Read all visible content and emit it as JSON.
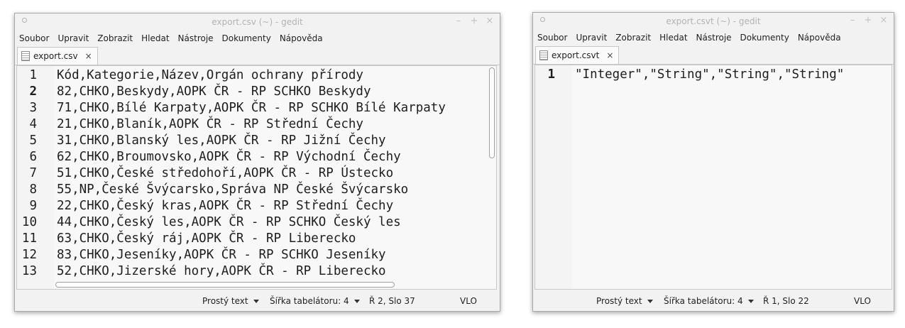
{
  "windows": [
    {
      "title": "export.csv (~) - gedit",
      "window_buttons": [
        "–",
        "+",
        "×"
      ],
      "menu": [
        "Soubor",
        "Upravit",
        "Zobrazit",
        "Hledat",
        "Nástroje",
        "Dokumenty",
        "Nápověda"
      ],
      "tab": {
        "label": "export.csv",
        "close": "×"
      },
      "current_line": 2,
      "lines": [
        {
          "num": "1",
          "text": "Kód,Kategorie,Název,Orgán ochrany přírody"
        },
        {
          "num": "2",
          "text": "82,CHKO,Beskydy,AOPK ČR - RP SCHKO Beskydy"
        },
        {
          "num": "3",
          "text": "71,CHKO,Bílé Karpaty,AOPK ČR - RP SCHKO Bílé Karpaty"
        },
        {
          "num": "4",
          "text": "21,CHKO,Blaník,AOPK ČR - RP Střední Čechy"
        },
        {
          "num": "5",
          "text": "31,CHKO,Blanský les,AOPK ČR - RP Jižní Čechy"
        },
        {
          "num": "6",
          "text": "62,CHKO,Broumovsko,AOPK ČR - RP Východní Čechy"
        },
        {
          "num": "7",
          "text": "51,CHKO,České středohoří,AOPK ČR - RP Ústecko"
        },
        {
          "num": "8",
          "text": "55,NP,České Švýcarsko,Správa NP České Švýcarsko"
        },
        {
          "num": "9",
          "text": "22,CHKO,Český kras,AOPK ČR - RP Střední Čechy"
        },
        {
          "num": "10",
          "text": "44,CHKO,Český les,AOPK ČR - RP SCHKO Český les"
        },
        {
          "num": "11",
          "text": "63,CHKO,Český ráj,AOPK ČR - RP Liberecko"
        },
        {
          "num": "12",
          "text": "83,CHKO,Jeseníky,AOPK ČR - RP SCHKO Jeseníky"
        },
        {
          "num": "13",
          "text": "52,CHKO,Jizerské hory,AOPK ČR - RP Liberecko"
        }
      ],
      "status": {
        "language": "Prostý text",
        "tab_width": "Šířka tabelátoru: 4",
        "position": "Ř 2, Slo 37",
        "mode": "VLO"
      }
    },
    {
      "title": "export.csvt (~) - gedit",
      "window_buttons": [
        "–",
        "+",
        "×"
      ],
      "menu": [
        "Soubor",
        "Upravit",
        "Zobrazit",
        "Hledat",
        "Nástroje",
        "Dokumenty",
        "Nápověda"
      ],
      "tab": {
        "label": "export.csvt",
        "close": "×"
      },
      "current_line": 1,
      "lines": [
        {
          "num": "1",
          "text": "\"Integer\",\"String\",\"String\",\"String\""
        }
      ],
      "status": {
        "language": "Prostý text",
        "tab_width": "Šířka tabelátoru: 4",
        "position": "Ř 1, Slo 22",
        "mode": "VLO"
      }
    }
  ]
}
